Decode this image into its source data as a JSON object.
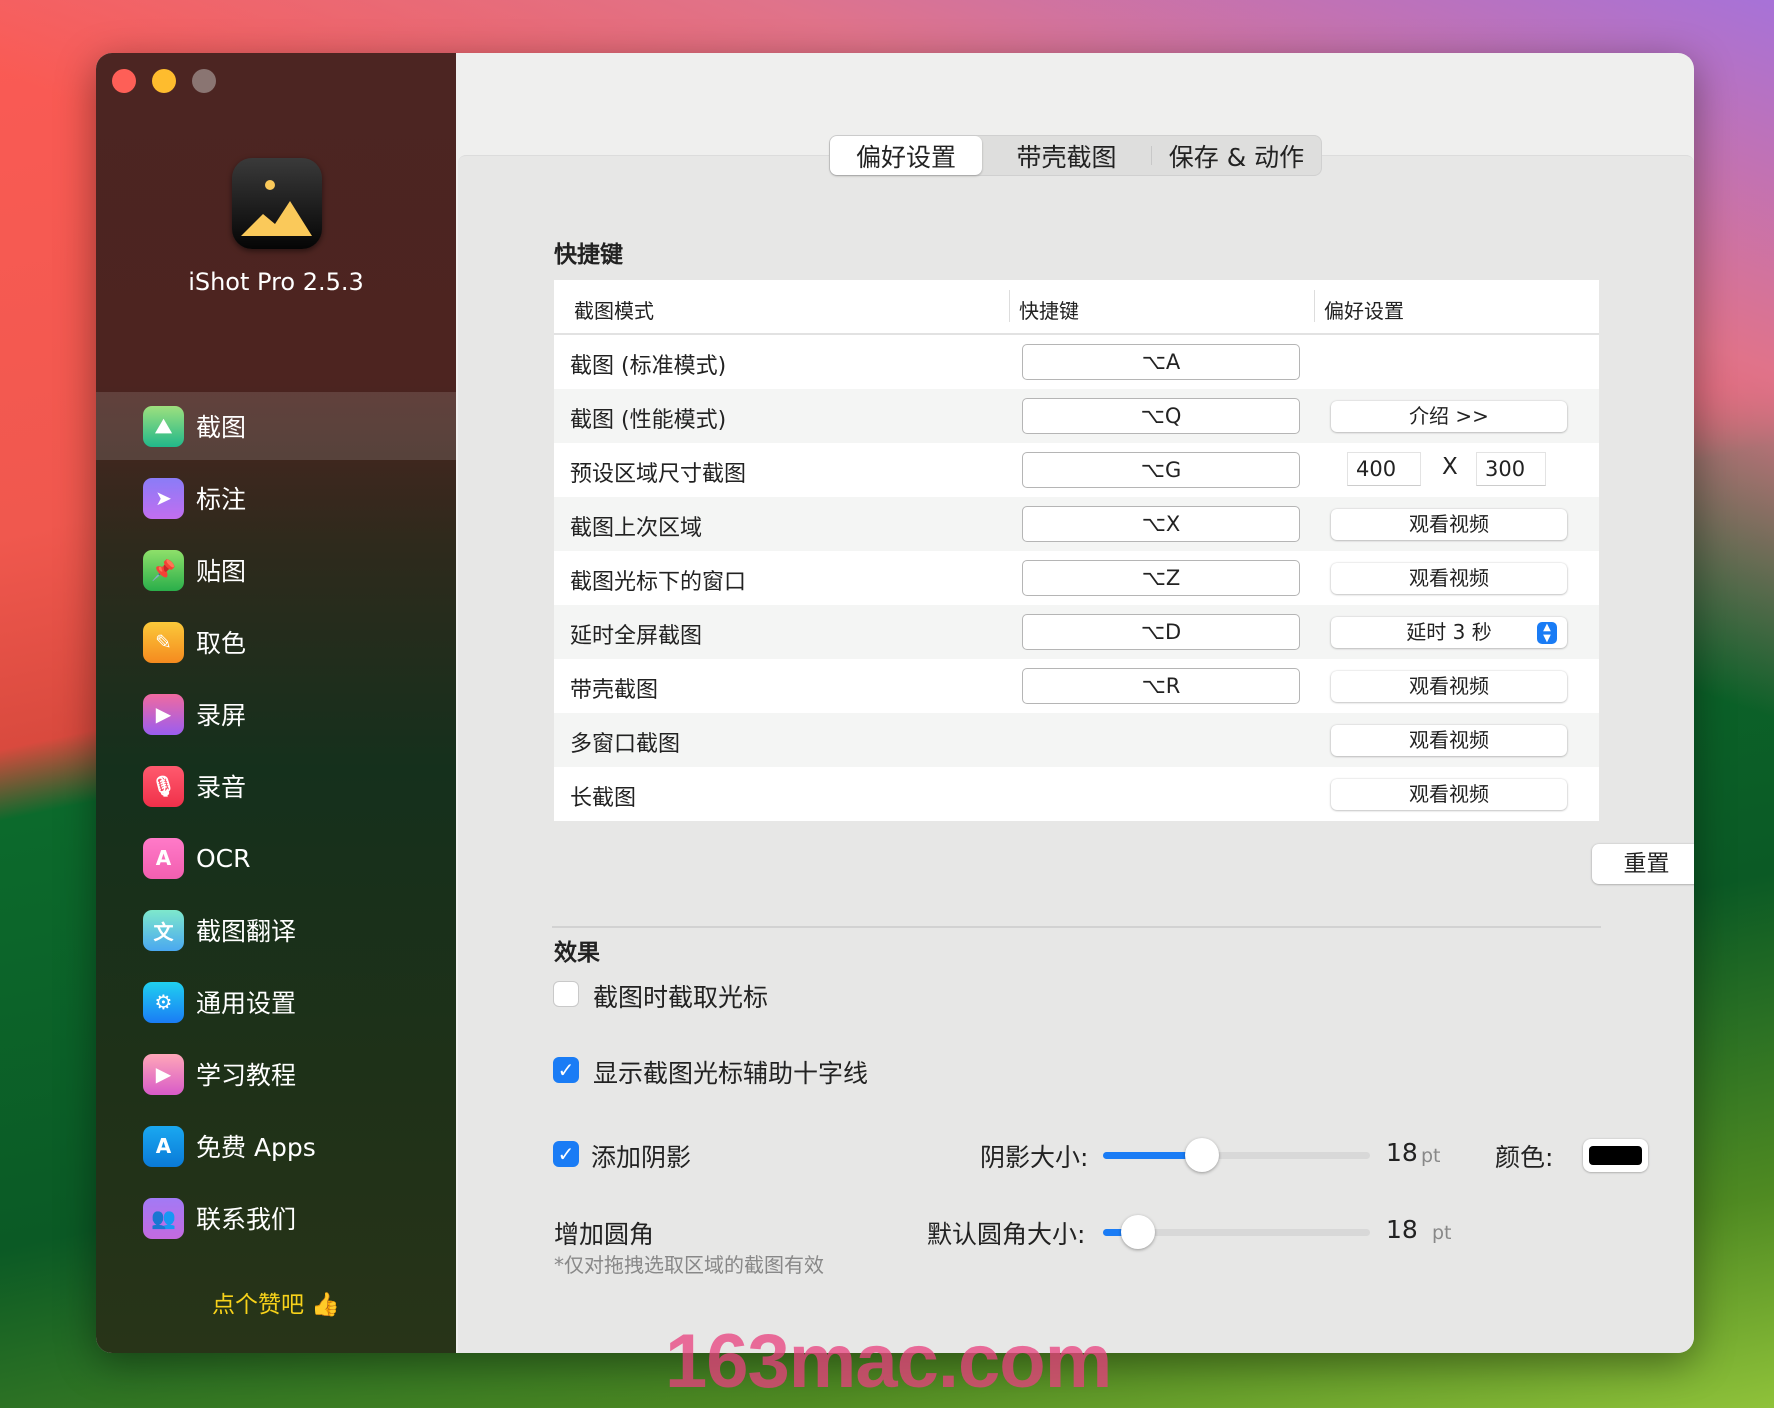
{
  "app": {
    "title": "iShot Pro 2.5.3",
    "like_label": "点个赞吧 👍"
  },
  "sidebar": {
    "items": [
      {
        "label": "截图",
        "icon": "image-icon",
        "glyph": "⛰",
        "color1": "#9ee07e",
        "color2": "#21b88a",
        "selected": true
      },
      {
        "label": "标注",
        "icon": "cursor-icon",
        "glyph": "➤",
        "color1": "#8a7cf7",
        "color2": "#c26ef0"
      },
      {
        "label": "贴图",
        "icon": "pin-icon",
        "glyph": "📌",
        "color1": "#8ee06a",
        "color2": "#2aae4a"
      },
      {
        "label": "取色",
        "icon": "eyedropper-icon",
        "glyph": "✎",
        "color1": "#fbc93a",
        "color2": "#f58a1f"
      },
      {
        "label": "录屏",
        "icon": "video-icon",
        "glyph": "▶",
        "color1": "#f06aa0",
        "color2": "#9a5df0"
      },
      {
        "label": "录音",
        "icon": "microphone-icon",
        "glyph": "🎙",
        "color1": "#ff5a6e",
        "color2": "#f0304a"
      },
      {
        "label": "OCR",
        "icon": "ocr-icon",
        "glyph": "A",
        "color1": "#ff7ac8",
        "color2": "#f25fb0"
      },
      {
        "label": "截图翻译",
        "icon": "translate-icon",
        "glyph": "文",
        "color1": "#7ee8cc",
        "color2": "#4aa8f0"
      },
      {
        "label": "通用设置",
        "icon": "gear-icon",
        "glyph": "⚙",
        "color1": "#20d0f0",
        "color2": "#1a7cf5"
      },
      {
        "label": "学习教程",
        "icon": "film-icon",
        "glyph": "▶",
        "color1": "#ffa7b8",
        "color2": "#d85ac8"
      },
      {
        "label": "免费 Apps",
        "icon": "app-store-icon",
        "glyph": "A",
        "color1": "#1aa8f0",
        "color2": "#0a7ad8"
      },
      {
        "label": "联系我们",
        "icon": "contacts-icon",
        "glyph": "👥",
        "color1": "#a27af5",
        "color2": "#c46ae0"
      }
    ]
  },
  "tabs": [
    {
      "label": "偏好设置",
      "active": true
    },
    {
      "label": "带壳截图"
    },
    {
      "label": "保存 & 动作"
    }
  ],
  "shortcuts": {
    "heading": "快捷键",
    "columns": [
      "截图模式",
      "快捷键",
      "偏好设置"
    ],
    "rows": [
      {
        "mode": "截图 (标准模式)",
        "key": "⌥A"
      },
      {
        "mode": "截图 (性能模式)",
        "key": "⌥Q",
        "button": "介绍  >>"
      },
      {
        "mode": "预设区域尺寸截图",
        "key": "⌥G",
        "width": "400",
        "x": "X",
        "height": "300"
      },
      {
        "mode": "截图上次区域",
        "key": "⌥X",
        "button": "观看视频"
      },
      {
        "mode": "截图光标下的窗口",
        "key": "⌥Z",
        "button": "观看视频"
      },
      {
        "mode": "延时全屏截图",
        "key": "⌥D",
        "select": "延时 3 秒"
      },
      {
        "mode": "带壳截图",
        "key": "⌥R",
        "button": "观看视频"
      },
      {
        "mode": "多窗口截图",
        "button": "观看视频"
      },
      {
        "mode": "长截图",
        "button": "观看视频"
      }
    ],
    "reset_label": "重置"
  },
  "effects": {
    "heading": "效果",
    "capture_cursor": {
      "label": "截图时截取光标",
      "checked": false
    },
    "crosshair": {
      "label": "显示截图光标辅助十字线",
      "checked": true
    },
    "shadow": {
      "label": "添加阴影",
      "checked": true,
      "size_label": "阴影大小:",
      "value": "18",
      "unit": "pt",
      "level": 0.37,
      "color_label": "颜色:",
      "color": "#000000"
    },
    "corner": {
      "label": "增加圆角",
      "size_label": "默认圆角大小:",
      "value": "18",
      "unit": "pt",
      "level": 0.13,
      "note": "*仅对拖拽选取区域的截图有效"
    }
  },
  "watermark": "163mac.com"
}
